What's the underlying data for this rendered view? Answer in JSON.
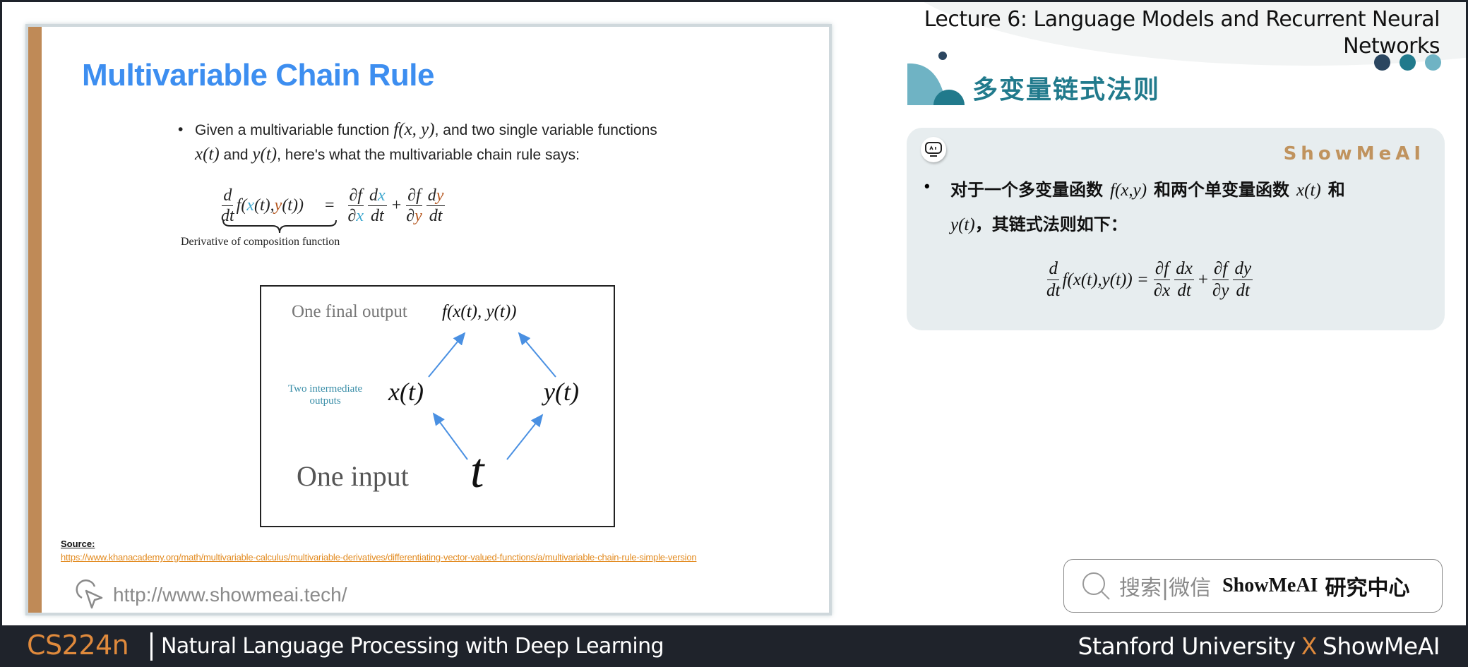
{
  "lecture": {
    "title_line1": "Lecture 6:  Language Models and Recurrent Neural",
    "title_line2": "Networks"
  },
  "slide": {
    "title": "Multivariable Chain Rule",
    "bullet": {
      "p1": "Given a multivariable function ",
      "f_xy": "f(x, y)",
      "p2": ", and two single variable functions",
      "x_t": "x(t)",
      "p3": " and ",
      "y_t": "y(t)",
      "p4": ", here's what the multivariable chain rule says:"
    },
    "equation": {
      "lhs_num": "d",
      "lhs_den": "dt",
      "lhs_f": "f(",
      "lhs_x": "x",
      "lhs_mid": "(t),",
      "lhs_y": "y",
      "lhs_end": "(t))",
      "eq": "=",
      "t1_num": "∂f",
      "t1_den_d": "∂",
      "t1_den_v": "x",
      "t2_num_d": "d",
      "t2_num_v": "x",
      "t2_den": "dt",
      "plus": "+",
      "t3_num": "∂f",
      "t3_den_d": "∂",
      "t3_den_v": "y",
      "t4_num_d": "d",
      "t4_num_v": "y",
      "t4_den": "dt",
      "brace_label": "Derivative of composition function"
    },
    "diagram": {
      "final_label": "One final output",
      "final_expr": "f(x(t), y(t))",
      "intermediate_label_1": "Two intermediate",
      "intermediate_label_2": "outputs",
      "x_node": "x(t)",
      "y_node": "y(t)",
      "input_label": "One input",
      "t_node": "t"
    },
    "source_label": "Source:",
    "source_url": "https://www.khanacademy.org/math/multivariable-calculus/multivariable-derivatives/differentiating-vector-valued-functions/a/multivariable-chain-rule-simple-version",
    "site_url": "http://www.showmeai.tech/"
  },
  "section": {
    "title": "多变量链式法则"
  },
  "card": {
    "brand": "ShowMeAI",
    "bullet": "•",
    "text_a": "对于一个多变量函数",
    "f_xy": "f(x,y)",
    "text_b": "和两个单变量函数",
    "x_t": "x(t)",
    "text_c": "和",
    "y_t": "y(t)",
    "text_d": "，其链式法则如下：",
    "eq": {
      "d": "d",
      "dt": "dt",
      "fx": "f(x(t),y(t)) =",
      "df": "∂f",
      "dx_den": "∂x",
      "dx": "dx",
      "dt2": "dt",
      "plus": "+",
      "df2": "∂f",
      "dy_den": "∂y",
      "dy": "dy",
      "dt3": "dt"
    }
  },
  "search": {
    "hint": "搜索|微信",
    "brand": "ShowMeAI",
    "brand_cn": "研究中心"
  },
  "footer": {
    "course_code": "CS224n",
    "course_name": "Natural Language Processing with Deep Learning",
    "credit_left": "Stanford University",
    "credit_x": "X",
    "credit_right": "ShowMeAI"
  },
  "colors": {
    "title_blue": "#3d8ef0",
    "accent_orange": "#e08a3c",
    "strip_brown": "#bf8a57",
    "teal": "#217a8c",
    "teal_light": "#6fb3c4",
    "navy": "#2b4660",
    "x_color": "#3fa8cf",
    "y_color": "#b5561e",
    "arrow_blue": "#4a90e2"
  }
}
